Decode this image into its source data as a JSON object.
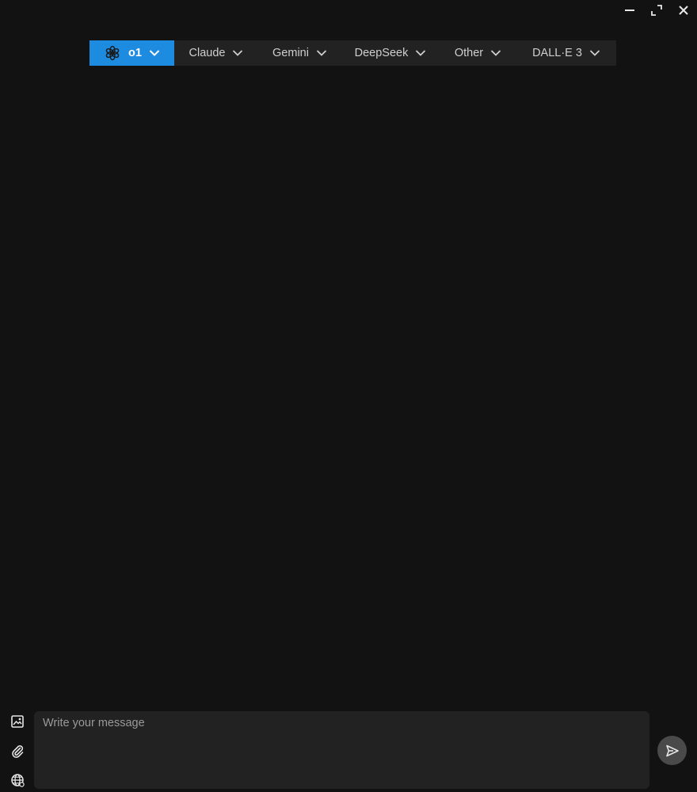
{
  "window": {
    "controls": [
      {
        "name": "minimize",
        "icon": "minimize-icon"
      },
      {
        "name": "maximize",
        "icon": "maximize-icon"
      },
      {
        "name": "close",
        "icon": "close-icon"
      }
    ]
  },
  "model_bar": {
    "accent_color": "#1d8be0",
    "tabs": [
      {
        "label": "o1",
        "active": true,
        "icon": "openai-logo-icon"
      },
      {
        "label": "Claude",
        "active": false
      },
      {
        "label": "Gemini",
        "active": false
      },
      {
        "label": "DeepSeek",
        "active": false
      },
      {
        "label": "Other",
        "active": false
      },
      {
        "label": "DALL·E 3",
        "active": false
      }
    ]
  },
  "composer": {
    "placeholder": "Write your message",
    "value": "",
    "tools": [
      {
        "name": "image",
        "icon": "image-icon"
      },
      {
        "name": "attach",
        "icon": "paperclip-icon"
      },
      {
        "name": "web",
        "icon": "globe-icon"
      }
    ],
    "send_icon": "send-icon"
  }
}
